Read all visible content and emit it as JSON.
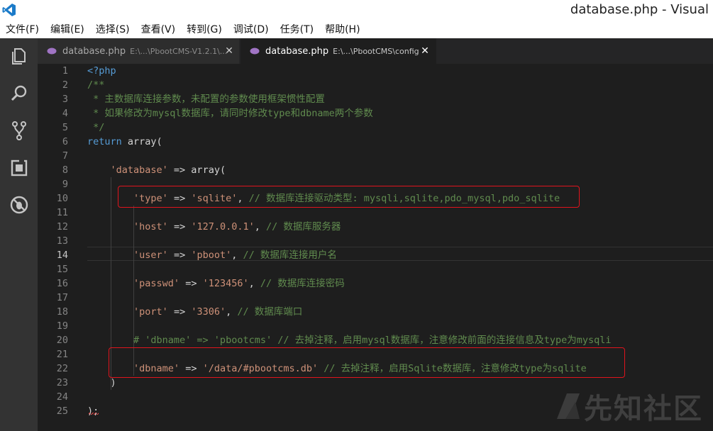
{
  "window": {
    "title": "database.php - Visual"
  },
  "menu": [
    "文件(F)",
    "编辑(E)",
    "选择(S)",
    "查看(V)",
    "转到(G)",
    "调试(D)",
    "任务(T)",
    "帮助(H)"
  ],
  "activity_icons": [
    "explorer-icon",
    "search-icon",
    "source-control-icon",
    "extensions-icon",
    "debug-icon"
  ],
  "tabs": [
    {
      "name": "database.php",
      "path": "E:\\...\\PbootCMS-V1.2.1\\...",
      "active": false
    },
    {
      "name": "database.php",
      "path": "E:\\...\\PbootCMS\\config",
      "active": true
    }
  ],
  "editor": {
    "current_line": 14,
    "lines": [
      {
        "n": "1",
        "t": "<?php"
      },
      {
        "n": "2",
        "t": "/**"
      },
      {
        "n": "3",
        "t": " * 主数据库连接参数，未配置的参数使用框架惯性配置"
      },
      {
        "n": "4",
        "t": " * 如果修改为mysql数据库，请同时修改type和dbname两个参数"
      },
      {
        "n": "5",
        "t": " */"
      },
      {
        "n": "6",
        "t": "return array("
      },
      {
        "n": "7",
        "t": ""
      },
      {
        "n": "8",
        "t": "    'database' => array("
      },
      {
        "n": "9",
        "t": ""
      },
      {
        "n": "10",
        "t": "        'type' => 'sqlite', // 数据库连接驱动类型: mysqli,sqlite,pdo_mysql,pdo_sqlite"
      },
      {
        "n": "11",
        "t": ""
      },
      {
        "n": "12",
        "t": "        'host' => '127.0.0.1', // 数据库服务器"
      },
      {
        "n": "13",
        "t": ""
      },
      {
        "n": "14",
        "t": "        'user' => 'pboot', // 数据库连接用户名"
      },
      {
        "n": "15",
        "t": ""
      },
      {
        "n": "16",
        "t": "        'passwd' => '123456', // 数据库连接密码"
      },
      {
        "n": "17",
        "t": ""
      },
      {
        "n": "18",
        "t": "        'port' => '3306', // 数据库端口"
      },
      {
        "n": "19",
        "t": ""
      },
      {
        "n": "20",
        "t": "        # 'dbname' => 'pbootcms' // 去掉注释，启用mysql数据库，注意修改前面的连接信息及type为mysqli"
      },
      {
        "n": "21",
        "t": ""
      },
      {
        "n": "22",
        "t": "        'dbname' => '/data/#pbootcms.db' // 去掉注释，启用Sqlite数据库，注意修改type为sqlite"
      },
      {
        "n": "23",
        "t": "    )"
      },
      {
        "n": "24",
        "t": ""
      },
      {
        "n": "25",
        "t": ");"
      }
    ]
  },
  "watermark": {
    "text": "先知社区"
  },
  "colors": {
    "keyword": "#569cd6",
    "comment": "#608b4e",
    "string": "#ce9178",
    "highlight": "#e0141d"
  }
}
